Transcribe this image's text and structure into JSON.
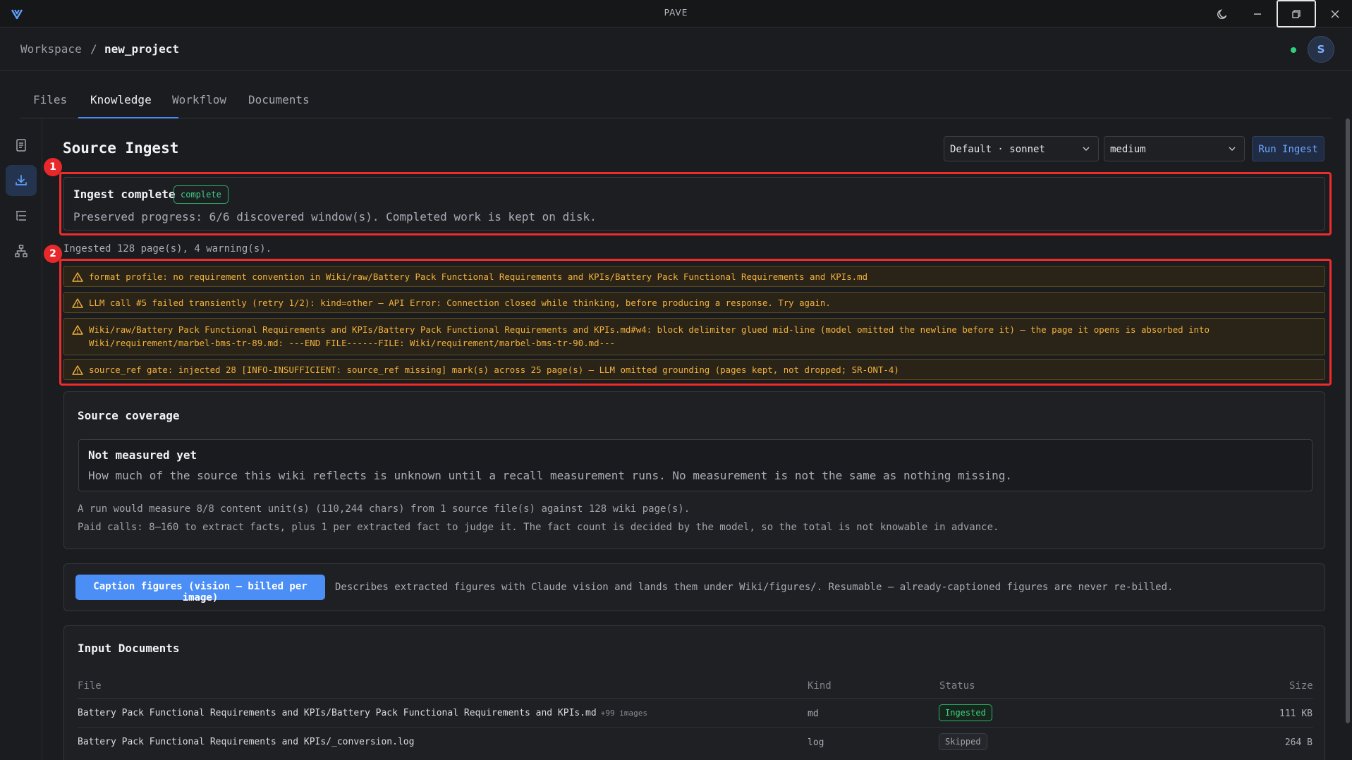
{
  "window": {
    "title": "PAVE"
  },
  "breadcrumb": {
    "root": "Workspace",
    "separator": "/",
    "current": "new_project",
    "avatar_initial": "S"
  },
  "tabs": [
    {
      "label": "Files",
      "active": false
    },
    {
      "label": "Knowledge",
      "active": true
    },
    {
      "label": "Workflow",
      "active": false
    },
    {
      "label": "Documents",
      "active": false
    }
  ],
  "rail": {
    "items": [
      {
        "icon": "document-list-icon",
        "active": false
      },
      {
        "icon": "download-icon",
        "active": true
      },
      {
        "icon": "list-tree-icon",
        "active": false
      },
      {
        "icon": "hierarchy-icon",
        "active": false
      }
    ]
  },
  "toolbar": {
    "title": "Source Ingest",
    "model_select": "Default · sonnet",
    "effort_select": "medium",
    "run_label": "Run Ingest"
  },
  "markers": [
    "1",
    "2"
  ],
  "ingest_status": {
    "title": "Ingest complete",
    "badge": "complete",
    "description": "Preserved progress: 6/6 discovered window(s). Completed work is kept on disk."
  },
  "summary": "Ingested 128 page(s), 4 warning(s).",
  "warnings": [
    "format profile: no requirement convention in Wiki/raw/Battery Pack Functional Requirements and KPIs/Battery Pack Functional Requirements and KPIs.md",
    "LLM call #5 failed transiently (retry 1/2): kind=other — API Error: Connection closed while thinking, before producing a response. Try again.",
    "Wiki/raw/Battery Pack Functional Requirements and KPIs/Battery Pack Functional Requirements and KPIs.md#w4: block delimiter glued mid-line (model omitted the newline before it) — the page it opens is absorbed into Wiki/requirement/marbel-bms-tr-89.md: ---END FILE------FILE: Wiki/requirement/marbel-bms-tr-90.md---",
    "source_ref gate: injected 28 [INFO-INSUFFICIENT: source_ref missing] mark(s) across 25 page(s) — LLM omitted grounding (pages kept, not dropped; SR-ONT-4)"
  ],
  "coverage": {
    "title": "Source coverage",
    "box_title": "Not measured yet",
    "box_desc": "How much of the source this wiki reflects is unknown until a recall measurement runs. No measurement is not the same as nothing missing.",
    "note1": "A run would measure 8/8 content unit(s) (110,244 chars) from 1 source file(s) against 128 wiki page(s).",
    "note2": "Paid calls: 8–160 to extract facts, plus 1 per extracted fact to judge it. The fact count is decided by the model, so the total is not knowable in advance."
  },
  "caption": {
    "button_label": "Caption figures (vision — billed per image)",
    "description": "Describes extracted figures with Claude vision and lands them under Wiki/figures/. Resumable — already-captioned figures are never re-billed."
  },
  "documents": {
    "title": "Input Documents",
    "columns": {
      "file": "File",
      "kind": "Kind",
      "status": "Status",
      "size": "Size"
    },
    "rows": [
      {
        "file": "Battery Pack Functional Requirements and KPIs/Battery Pack Functional Requirements and KPIs.md",
        "extra": "+99 images",
        "kind": "md",
        "status": "Ingested",
        "size": "111 KB"
      },
      {
        "file": "Battery Pack Functional Requirements and KPIs/_conversion.log",
        "extra": "",
        "kind": "log",
        "status": "Skipped",
        "size": "264 B"
      }
    ]
  },
  "colors": {
    "accent": "#4b8ef5",
    "success": "#3fd083",
    "warning": "#f3b13b",
    "highlight": "#ee2c2c"
  }
}
